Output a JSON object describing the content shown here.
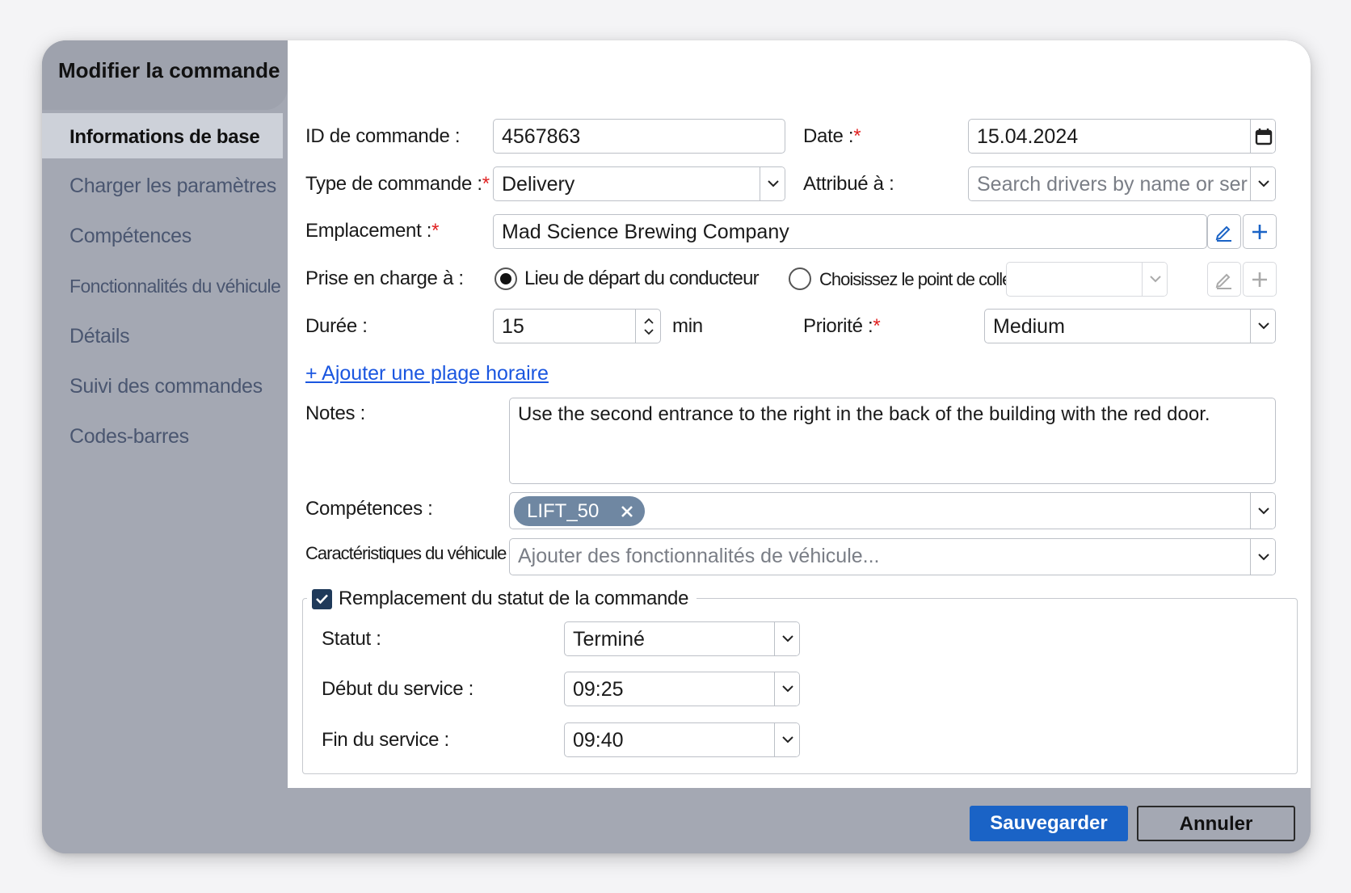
{
  "dialog": {
    "title": "Modifier la commande"
  },
  "sidebar": {
    "items": [
      {
        "label": "Informations de base",
        "active": true
      },
      {
        "label": "Charger les paramètres",
        "active": false
      },
      {
        "label": "Compétences",
        "active": false
      },
      {
        "label": "Fonctionnalités du véhicule",
        "active": false
      },
      {
        "label": "Détails",
        "active": false
      },
      {
        "label": "Suivi des commandes",
        "active": false
      },
      {
        "label": "Codes-barres",
        "active": false
      }
    ]
  },
  "form": {
    "order_id": {
      "label": "ID de commande :",
      "value": "4567863"
    },
    "date": {
      "label": "Date :",
      "required_mark": "*",
      "value": "15.04.2024"
    },
    "order_type": {
      "label": "Type de commande :",
      "required_mark": "*",
      "value": "Delivery"
    },
    "assigned_to": {
      "label": "Attribué à :",
      "placeholder": "Search drivers by name or ser"
    },
    "location": {
      "label": "Emplacement :",
      "required_mark": "*",
      "value": "Mad Science Brewing Company"
    },
    "pickup": {
      "label": "Prise en charge à :",
      "option_driver_start": "Lieu de départ du conducteur",
      "option_pickup_point": "Choisissez le point de collecte :",
      "selected": "driver_start"
    },
    "duration": {
      "label": "Durée :",
      "value": "15",
      "unit": "min"
    },
    "priority": {
      "label": "Priorité :",
      "required_mark": "*",
      "value": "Medium"
    },
    "add_time_window": "+ Ajouter une plage horaire",
    "notes": {
      "label": "Notes :",
      "value": "Use the second entrance to the right in the back of the building with the red door."
    },
    "skills": {
      "label": "Compétences :",
      "chips": [
        "LIFT_50"
      ]
    },
    "vehicle_features": {
      "label": "Caractéristiques du véhicule :",
      "placeholder": "Ajouter des fonctionnalités de véhicule..."
    },
    "status_override": {
      "legend": "Remplacement du statut de la commande",
      "checked": true,
      "status": {
        "label": "Statut :",
        "value": "Terminé"
      },
      "service_start": {
        "label": "Début du service :",
        "value": "09:25"
      },
      "service_end": {
        "label": "Fin du service :",
        "value": "09:40"
      }
    }
  },
  "footer": {
    "save_label": "Sauvegarder",
    "cancel_label": "Annuler"
  },
  "colors": {
    "accent": "#1a63c6",
    "link": "#1a56e0",
    "required": "#e02020",
    "chip": "#6f87a2",
    "sidebar_bg": "#a4a8b3"
  }
}
